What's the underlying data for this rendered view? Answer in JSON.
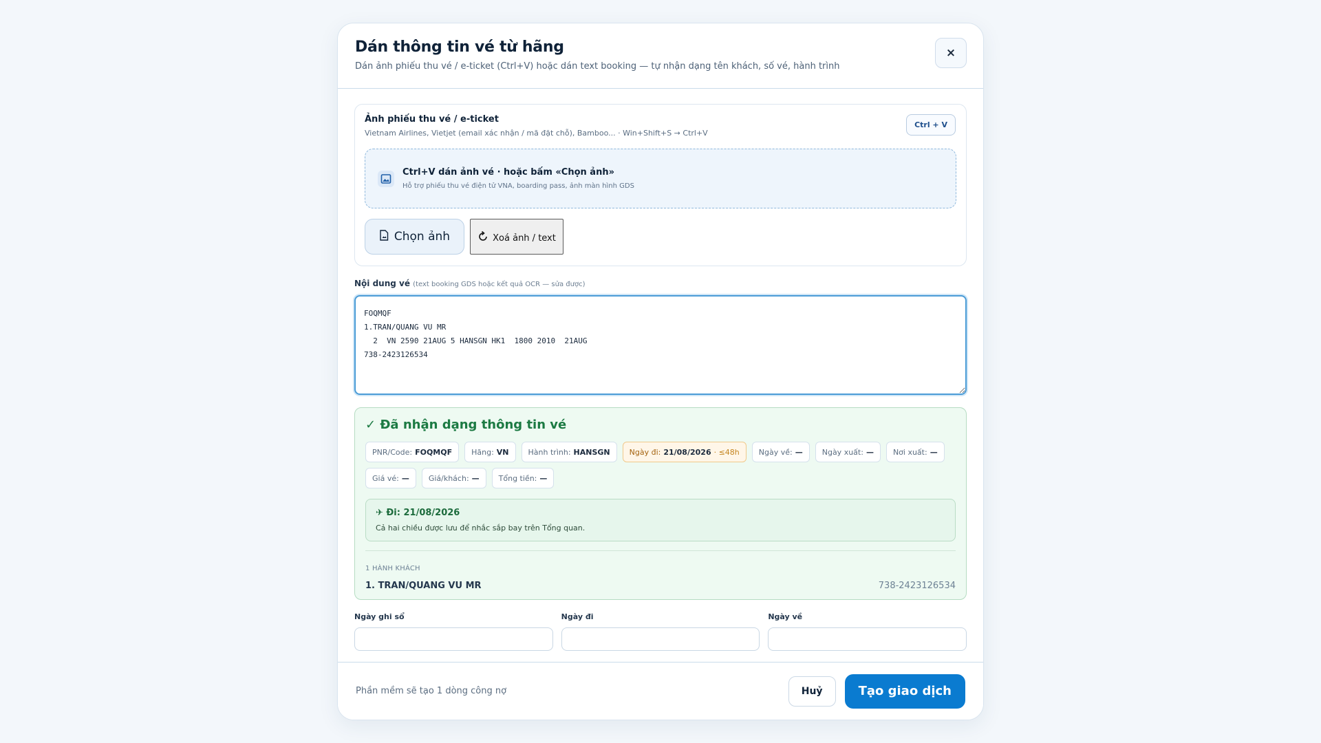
{
  "header": {
    "title": "Dán thông tin vé từ hãng",
    "subtitle": "Dán ảnh phiếu thu vé / e-ticket (Ctrl+V) hoặc dán text booking — tự nhận dạng tên khách, số vé, hành trình",
    "close_label": "×"
  },
  "upload": {
    "title": "Ảnh phiếu thu vé / e-ticket",
    "subtitle": "Vietnam Airlines, Vietjet (email xác nhận / mã đặt chỗ), Bamboo... · Win+Shift+S → Ctrl+V",
    "shortcut_badge": "Ctrl + V",
    "dropzone_title": "Ctrl+V dán ảnh vé · hoặc bấm «Chọn ảnh»",
    "dropzone_sub": "Hỗ trợ phiếu thu vé điện tử VNA, boarding pass, ảnh màn hình GDS",
    "choose_label": "Chọn ảnh",
    "clear_label": "Xoá ảnh / text"
  },
  "ticket_content": {
    "label": "Nội dung vé",
    "hint": "(text booking GDS hoặc kết quả OCR — sửa được)",
    "value": "FOQMQF\n1.TRAN/QUANG VU MR\n  2  VN 2590 21AUG 5 HANSGN HK1  1800 2010  21AUG\n738-2423126534"
  },
  "result": {
    "title": "✓ Đã nhận dạng thông tin vé",
    "chips": [
      {
        "label": "PNR/Code:",
        "value": "FOQMQF"
      },
      {
        "label": "Hãng:",
        "value": "VN"
      },
      {
        "label": "Hành trình:",
        "value": "HANSGN"
      },
      {
        "label": "Ngày đi:",
        "value": "21/08/2026",
        "suffix": "· ≤48h"
      },
      {
        "label": "Ngày về:",
        "value": "—"
      },
      {
        "label": "Ngày xuất:",
        "value": "—"
      },
      {
        "label": "Nơi xuất:",
        "value": "—"
      },
      {
        "label": "Giá vé:",
        "value": "—"
      },
      {
        "label": "Giá/khách:",
        "value": "—"
      },
      {
        "label": "Tổng tiền:",
        "value": "—"
      }
    ],
    "flight_title": "✈ Đi: 21/08/2026",
    "flight_note": "Cả hai chiều được lưu để nhắc sắp bay trên Tổng quan.",
    "passenger_count": "1 HÀNH KHÁCH",
    "passenger_name": "1. TRAN/QUANG VU MR",
    "passenger_ticket": "738-2423126534"
  },
  "dates": {
    "booking_label": "Ngày ghi sổ",
    "depart_label": "Ngày đi",
    "return_label": "Ngày về"
  },
  "footer": {
    "note": "Phần mềm sẽ tạo 1 dòng công nợ",
    "cancel_label": "Huỷ",
    "create_label": "Tạo giao dịch"
  },
  "colors": {
    "primary": "#0a7bd0",
    "success": "#1c7a43",
    "warning": "#c4841e"
  }
}
